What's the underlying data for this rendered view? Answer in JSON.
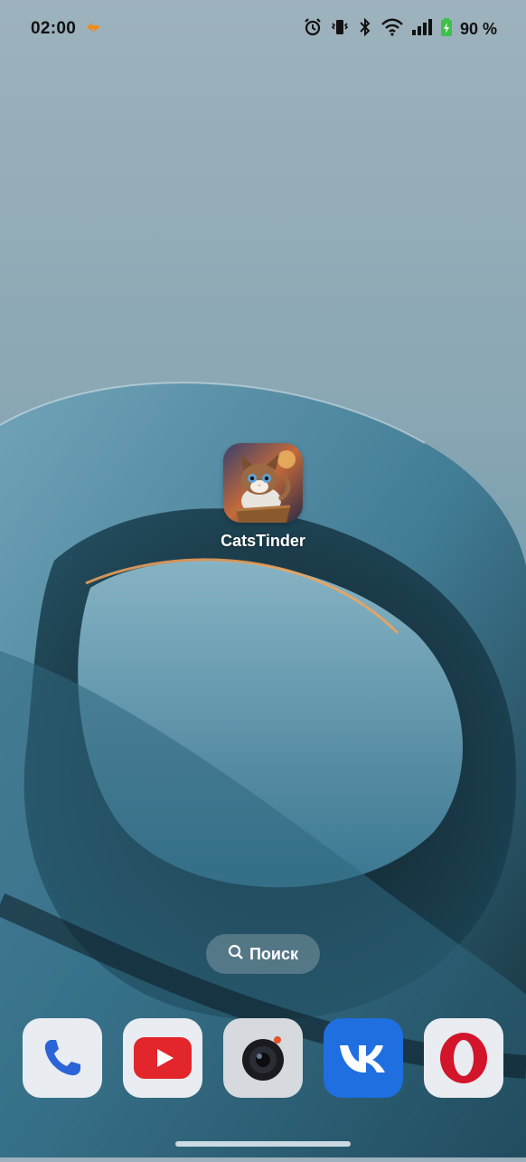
{
  "status_bar": {
    "time": "02:00",
    "battery_percent": "90 %",
    "icons": [
      "data-saver-icon",
      "alarm-icon",
      "vibrate-icon",
      "bluetooth-icon",
      "wifi-icon",
      "signal-icon",
      "battery-charging-icon"
    ]
  },
  "home": {
    "app": {
      "label": "CatsTinder",
      "icon": "cat-kitten-icon"
    },
    "search": {
      "label": "Поиск",
      "icon": "search-icon"
    }
  },
  "dock": {
    "apps": [
      {
        "name": "phone",
        "icon": "phone-icon"
      },
      {
        "name": "youtube",
        "icon": "youtube-icon"
      },
      {
        "name": "camera",
        "icon": "camera-icon"
      },
      {
        "name": "vk",
        "icon": "vk-icon"
      },
      {
        "name": "opera",
        "icon": "opera-icon"
      }
    ]
  },
  "colors": {
    "vk_blue": "#1f6fe0",
    "youtube_red": "#e2262c",
    "opera_red": "#d2152b",
    "phone_blue": "#2b64d6",
    "status_accent": "#f08a1c"
  }
}
